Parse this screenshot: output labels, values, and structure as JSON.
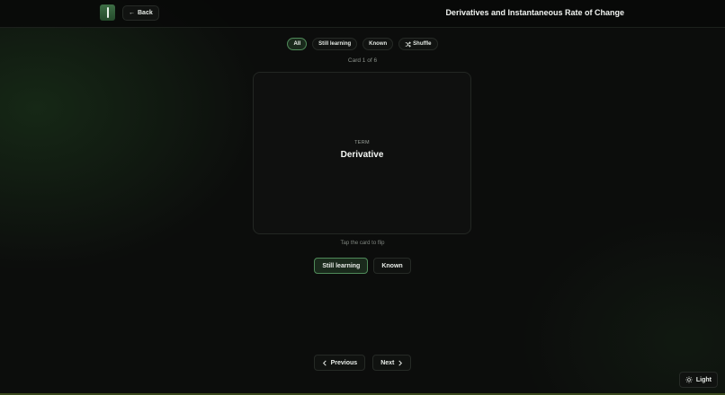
{
  "header": {
    "logo_icon": "flashcard-logo-icon",
    "back_label": "Back",
    "back_icon": "arrow-left-icon",
    "title": "Derivatives and Instantaneous Rate of Change"
  },
  "filters": {
    "all": "All",
    "still_learning": "Still learning",
    "known": "Known",
    "shuffle": "Shuffle",
    "shuffle_icon": "shuffle-icon",
    "active": "All"
  },
  "counter": "Card 1 of 6",
  "card": {
    "kind": "TERM",
    "term": "Derivative"
  },
  "hint": "Tap the card to flip",
  "status": {
    "still_learning": "Still learning",
    "known": "Known",
    "active": "Still learning"
  },
  "pager": {
    "previous": "Previous",
    "next": "Next"
  },
  "theme": {
    "label": "Light",
    "icon": "sun-icon"
  },
  "colors": {
    "background": "#0c0d0c",
    "accent": "#4f8a59",
    "accent_bg": "#1a2a1c",
    "logo": "#3d6e45"
  }
}
